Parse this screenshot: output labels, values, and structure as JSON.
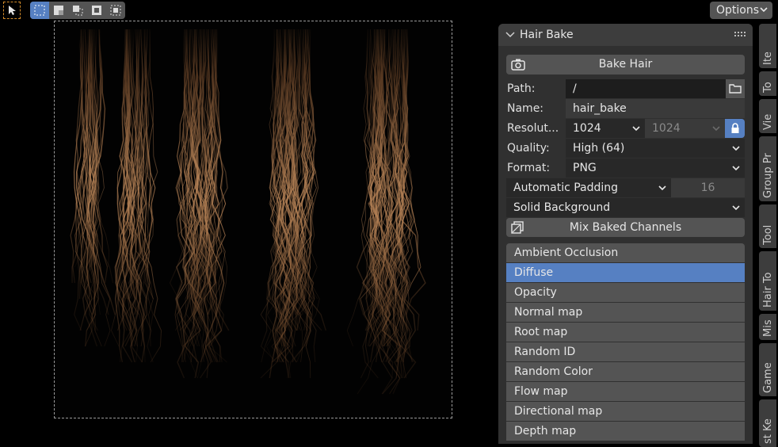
{
  "header": {
    "options_label": "Options"
  },
  "panel": {
    "title": "Hair Bake",
    "bake_button": "Bake Hair",
    "path_label": "Path:",
    "path_value": "/",
    "name_label": "Name:",
    "name_value": "hair_bake",
    "resolution_label": "Resolut...",
    "resolution_x": "1024",
    "resolution_y": "1024",
    "quality_label": "Quality:",
    "quality_value": "High (64)",
    "format_label": "Format:",
    "format_value": "PNG",
    "padding_mode": "Automatic Padding",
    "padding_value": "16",
    "background_mode": "Solid Background",
    "mix_channels_label": "Mix Baked Channels",
    "channels": [
      "Ambient Occlusion",
      "Diffuse",
      "Opacity",
      "Normal map",
      "Root map",
      "Random ID",
      "Random Color",
      "Flow map",
      "Directional map",
      "Depth map"
    ],
    "selected_channel": "Diffuse"
  },
  "tabs": [
    "Ite",
    "To",
    "Vie",
    "Group Pr",
    "Tool",
    "Hair To",
    "Mis",
    "Game",
    "st Ke"
  ],
  "colors": {
    "accent": "#5680c2",
    "button": "#545454",
    "panel_bg": "#303030",
    "hair_light": "#b98558",
    "hair_dark": "#5a3a22"
  },
  "icons": [
    "select-tool-icon",
    "new-selection-icon",
    "extend-selection-icon",
    "subtract-selection-icon",
    "invert-selection-icon",
    "intersect-selection-icon",
    "camera-icon",
    "folder-icon",
    "lock-icon",
    "collapse-arrow-icon",
    "drag-grip-icon",
    "mix-channels-icon"
  ]
}
